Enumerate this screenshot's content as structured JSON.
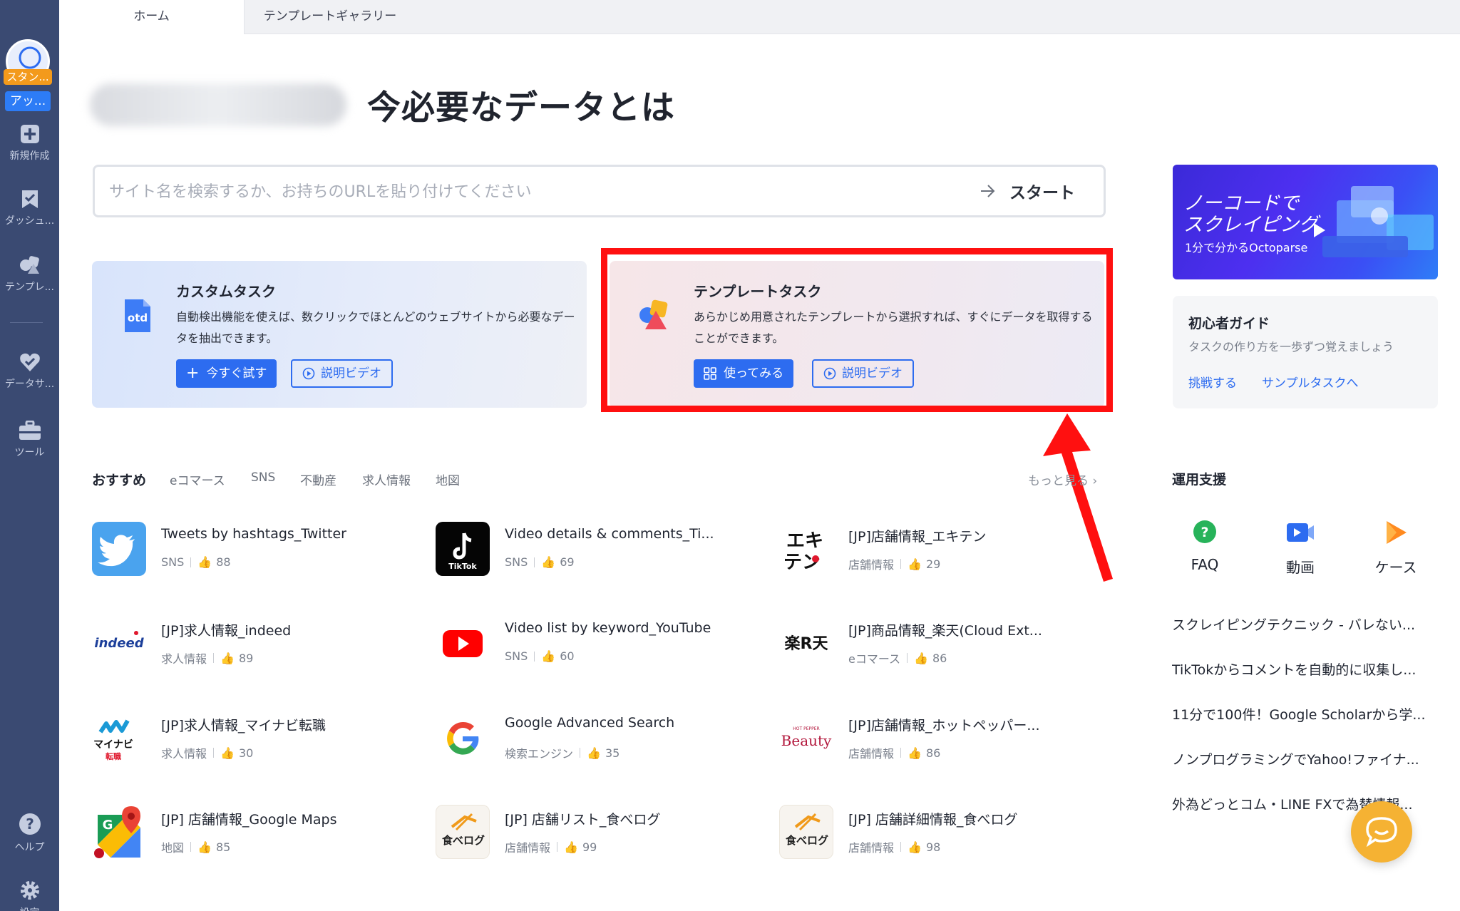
{
  "sidebar": {
    "plan_badge": "スタン...",
    "upgrade_badge": "アッ...",
    "items": [
      {
        "label": "新規作成"
      },
      {
        "label": "ダッシュ..."
      },
      {
        "label": "テンプレ..."
      },
      {
        "label": "データサ..."
      },
      {
        "label": "ツール"
      },
      {
        "label": "ヘルプ"
      },
      {
        "label": "設定"
      }
    ]
  },
  "tabs": [
    {
      "label": "ホーム"
    },
    {
      "label": "テンプレートギャラリー"
    }
  ],
  "header": {
    "title": "今必要なデータとは"
  },
  "search": {
    "placeholder": "サイト名を検索するか、お持ちのURLを貼り付けてください",
    "start_label": "スタート"
  },
  "cards": {
    "custom": {
      "icon_text": "otd",
      "title": "カスタムタスク",
      "desc": "自動検出機能を使えば、数クリックでほとんどのウェブサイトから必要なデータを抽出できます。",
      "primary_label": "今すぐ試す",
      "video_label": "説明ビデオ"
    },
    "template": {
      "title": "テンプレートタスク",
      "desc": "あらかじめ用意されたテンプレートから選択すれば、すぐにデータを取得することができます。",
      "primary_label": "使ってみる",
      "video_label": "説明ビデオ"
    }
  },
  "promo": {
    "title": "ノーコードで\nスクレイピング",
    "subtitle": "1分で分かるOctoparse"
  },
  "guide": {
    "title": "初心者ガイド",
    "subtitle": "タスクの作り方を一歩ずつ覚えましょう",
    "link1": "挑戦する",
    "link2": "サンプルタスクへ"
  },
  "support": {
    "title": "運用支援",
    "items": [
      {
        "label": "FAQ"
      },
      {
        "label": "動画"
      },
      {
        "label": "ケース"
      }
    ],
    "articles": [
      "スクレイピングテクニック - バレない...",
      "TikTokからコメントを自動的に収集し...",
      "11分で100件！Google Scholarから学...",
      "ノンプログラミングでYahoo!ファイナ...",
      "外為どっとコム・LINE FXで為替情報..."
    ]
  },
  "recommend": {
    "tabs": [
      "おすすめ",
      "eコマース",
      "SNS",
      "不動産",
      "求人情報",
      "地図"
    ],
    "more": "もっと見る",
    "templates": [
      {
        "name": "Tweets by hashtags_Twitter",
        "category": "SNS",
        "likes": "88"
      },
      {
        "name": "Video details & comments_Ti...",
        "category": "SNS",
        "likes": "69",
        "icon_text": "TikTok"
      },
      {
        "name": "[JP]店舗情報_エキテン",
        "category": "店舗情報",
        "likes": "29",
        "icon_text": "エキ\nテン"
      },
      {
        "name": "[JP]求人情報_indeed",
        "category": "求人情報",
        "likes": "89",
        "icon_text": "indeed"
      },
      {
        "name": "Video list by keyword_YouTube",
        "category": "SNS",
        "likes": "60"
      },
      {
        "name": "[JP]商品情報_楽天(Cloud Ext...",
        "category": "eコマース",
        "likes": "86",
        "icon_text": "楽R天"
      },
      {
        "name": "[JP]求人情報_マイナビ転職",
        "category": "求人情報",
        "likes": "30",
        "icon_text": "マイナビ\n転職"
      },
      {
        "name": "Google Advanced Search",
        "category": "検索エンジン",
        "likes": "35"
      },
      {
        "name": "[JP]店舗情報_ホットペッパー...",
        "category": "店舗情報",
        "likes": "86",
        "icon_text": "Beauty"
      },
      {
        "name": "[JP] 店舗情報_Google Maps",
        "category": "地図",
        "likes": "85"
      },
      {
        "name": "[JP] 店舗リスト_食べログ",
        "category": "店舗情報",
        "likes": "99",
        "icon_text": "食べログ"
      },
      {
        "name": "[JP] 店舗詳細情報_食べログ",
        "category": "店舗情報",
        "likes": "98",
        "icon_text": "食べログ"
      }
    ]
  },
  "colors": {
    "sidebar": "#3a4a72",
    "primary": "#2d6cf0",
    "highlight": "#ff1010",
    "chat": "#f5b233"
  }
}
